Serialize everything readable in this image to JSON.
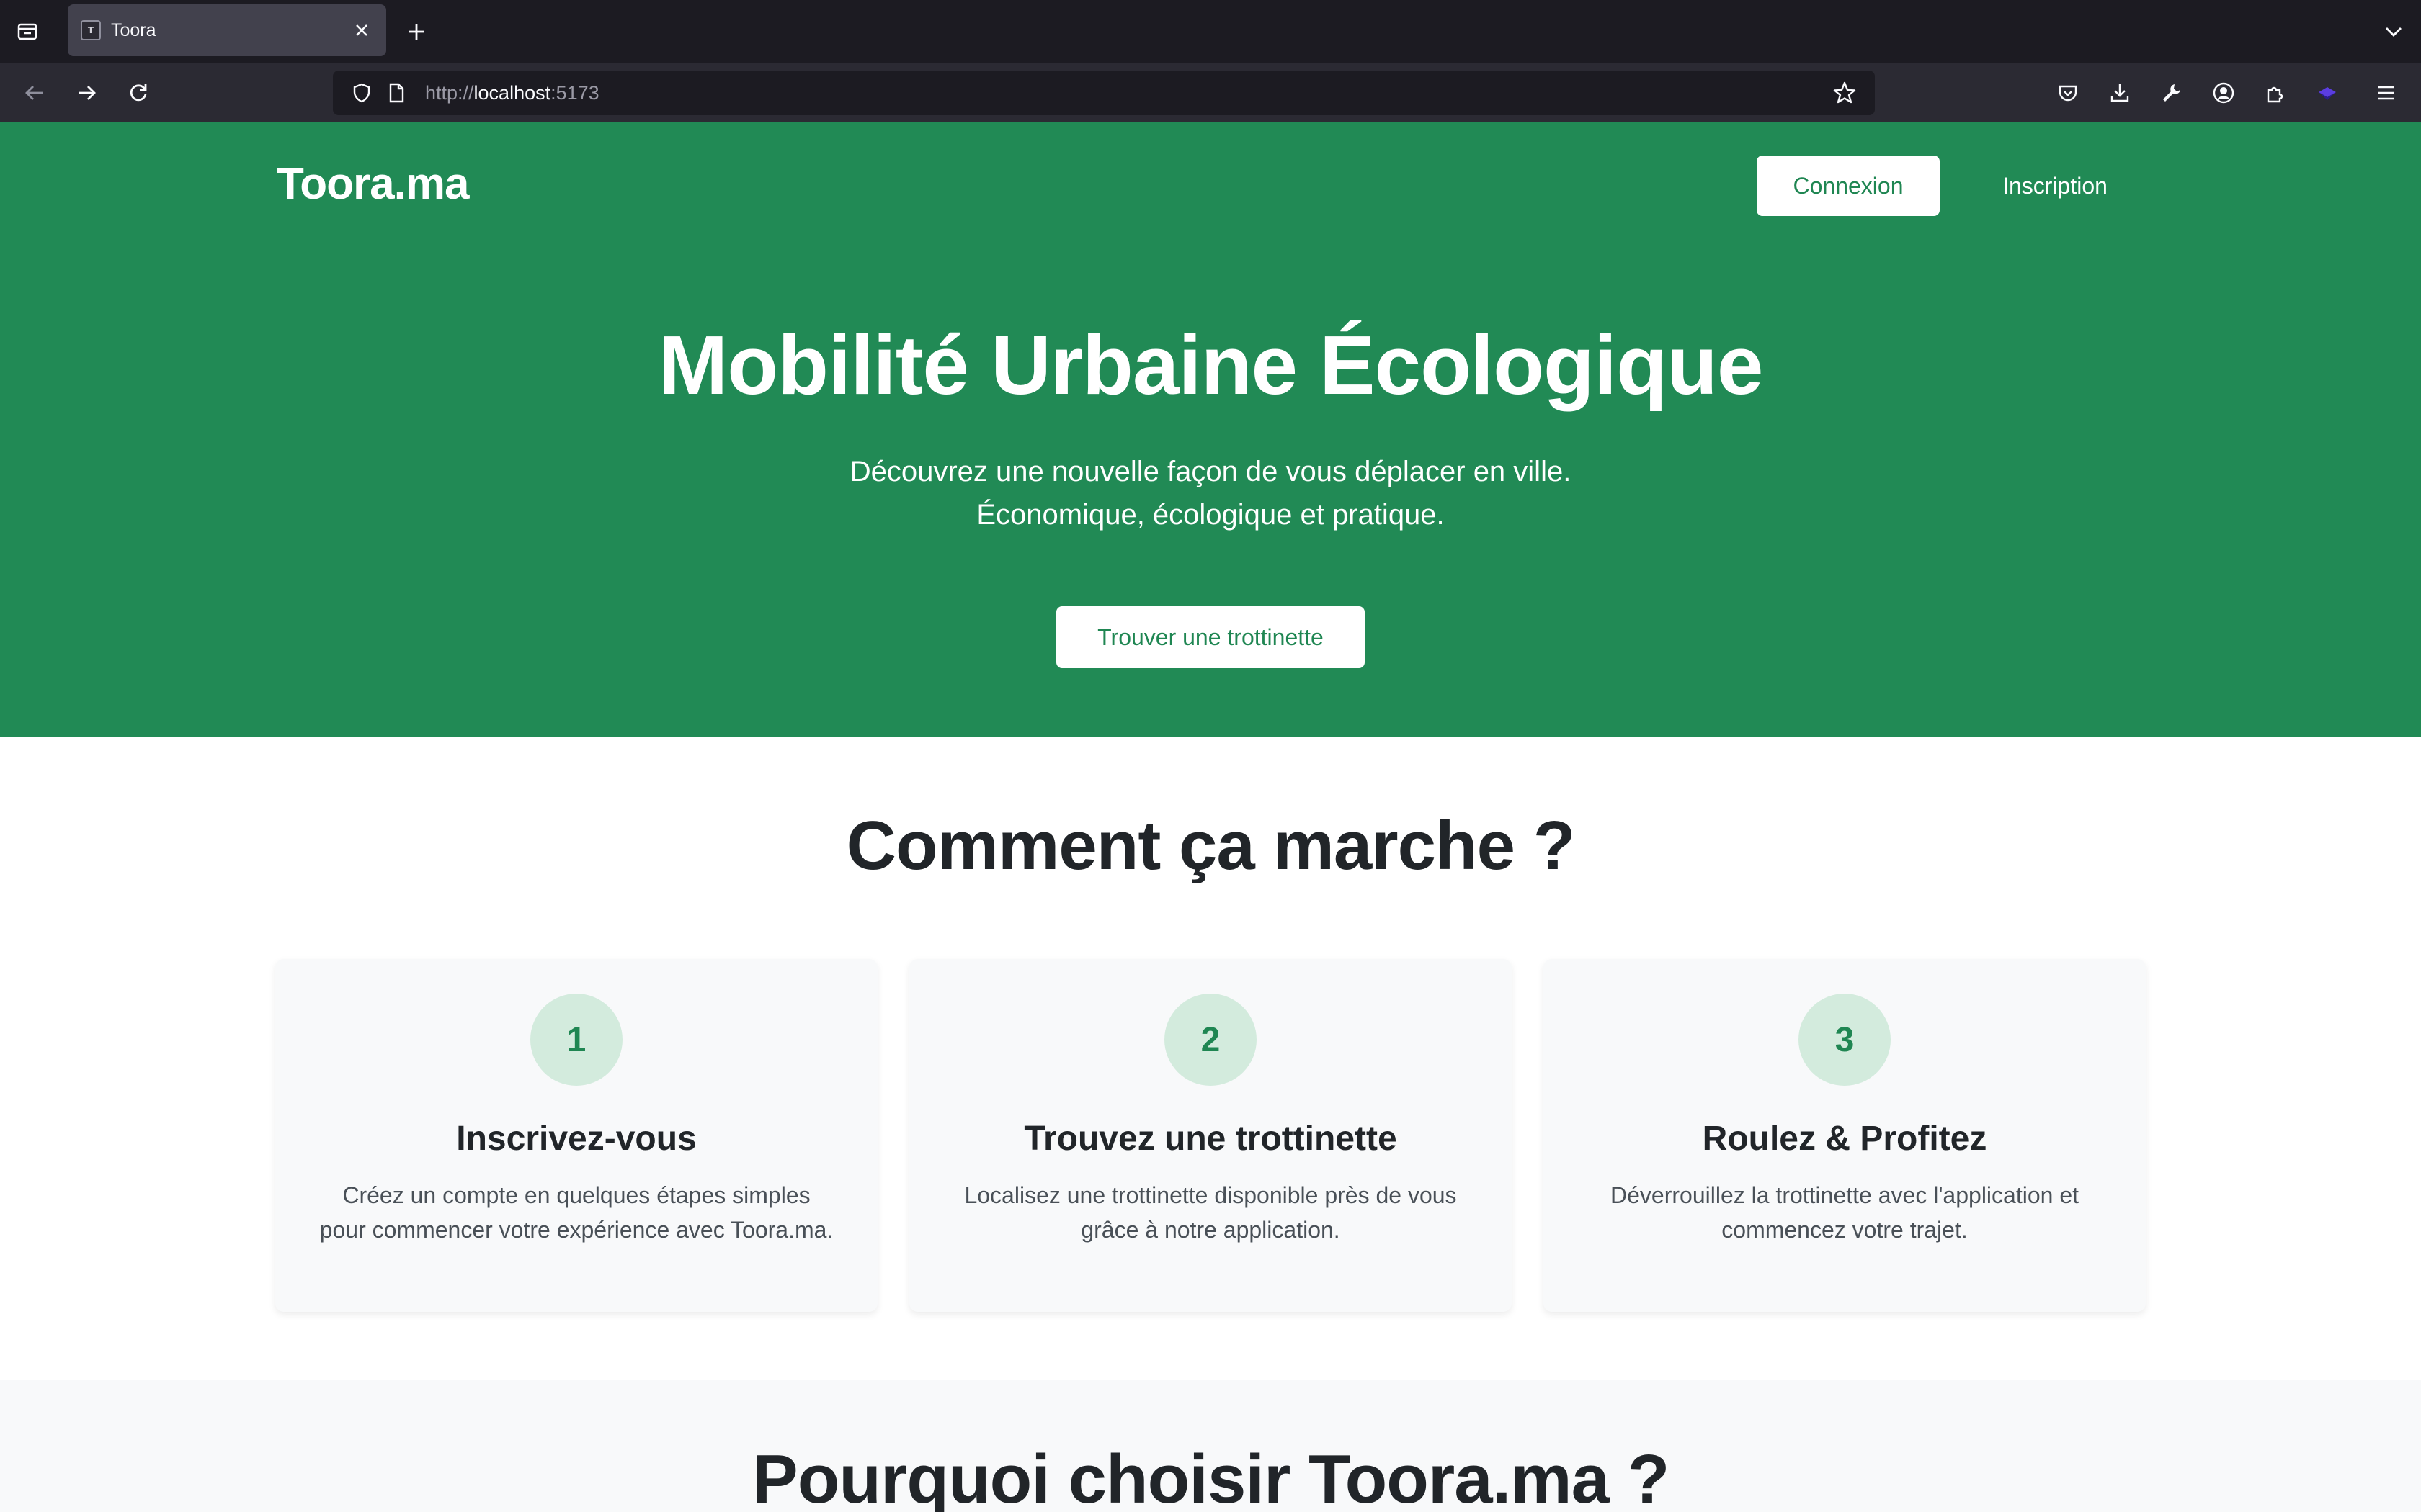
{
  "browser": {
    "tab": {
      "title": "Toora",
      "favicon_text": "Toora"
    },
    "url": {
      "scheme": "http://",
      "host": "localhost",
      "port": ":5173"
    }
  },
  "site": {
    "brand": "Toora.ma",
    "nav": {
      "login_label": "Connexion",
      "signup_label": "Inscription"
    },
    "colors": {
      "primary": "#218a55",
      "text_dark": "#212529",
      "step_bg": "#d3ebdd"
    }
  },
  "hero": {
    "title": "Mobilité Urbaine Écologique",
    "subtitle_line1": "Découvrez une nouvelle façon de vous déplacer en ville.",
    "subtitle_line2": "Économique, écologique et pratique.",
    "cta_label": "Trouver une trottinette"
  },
  "how": {
    "title": "Comment ça marche ?",
    "steps": [
      {
        "number": "1",
        "title": "Inscrivez-vous",
        "line1": "Créez un compte en quelques étapes simples",
        "line2": "pour commencer votre expérience avec Toora.ma."
      },
      {
        "number": "2",
        "title": "Trouvez une trottinette",
        "line1": "Localisez une trottinette disponible près de vous",
        "line2": "grâce à notre application."
      },
      {
        "number": "3",
        "title": "Roulez & Profitez",
        "line1": "Déverrouillez la trottinette avec l'application et",
        "line2": "commencez votre trajet."
      }
    ]
  },
  "why": {
    "title": "Pourquoi choisir Toora.ma ?"
  }
}
